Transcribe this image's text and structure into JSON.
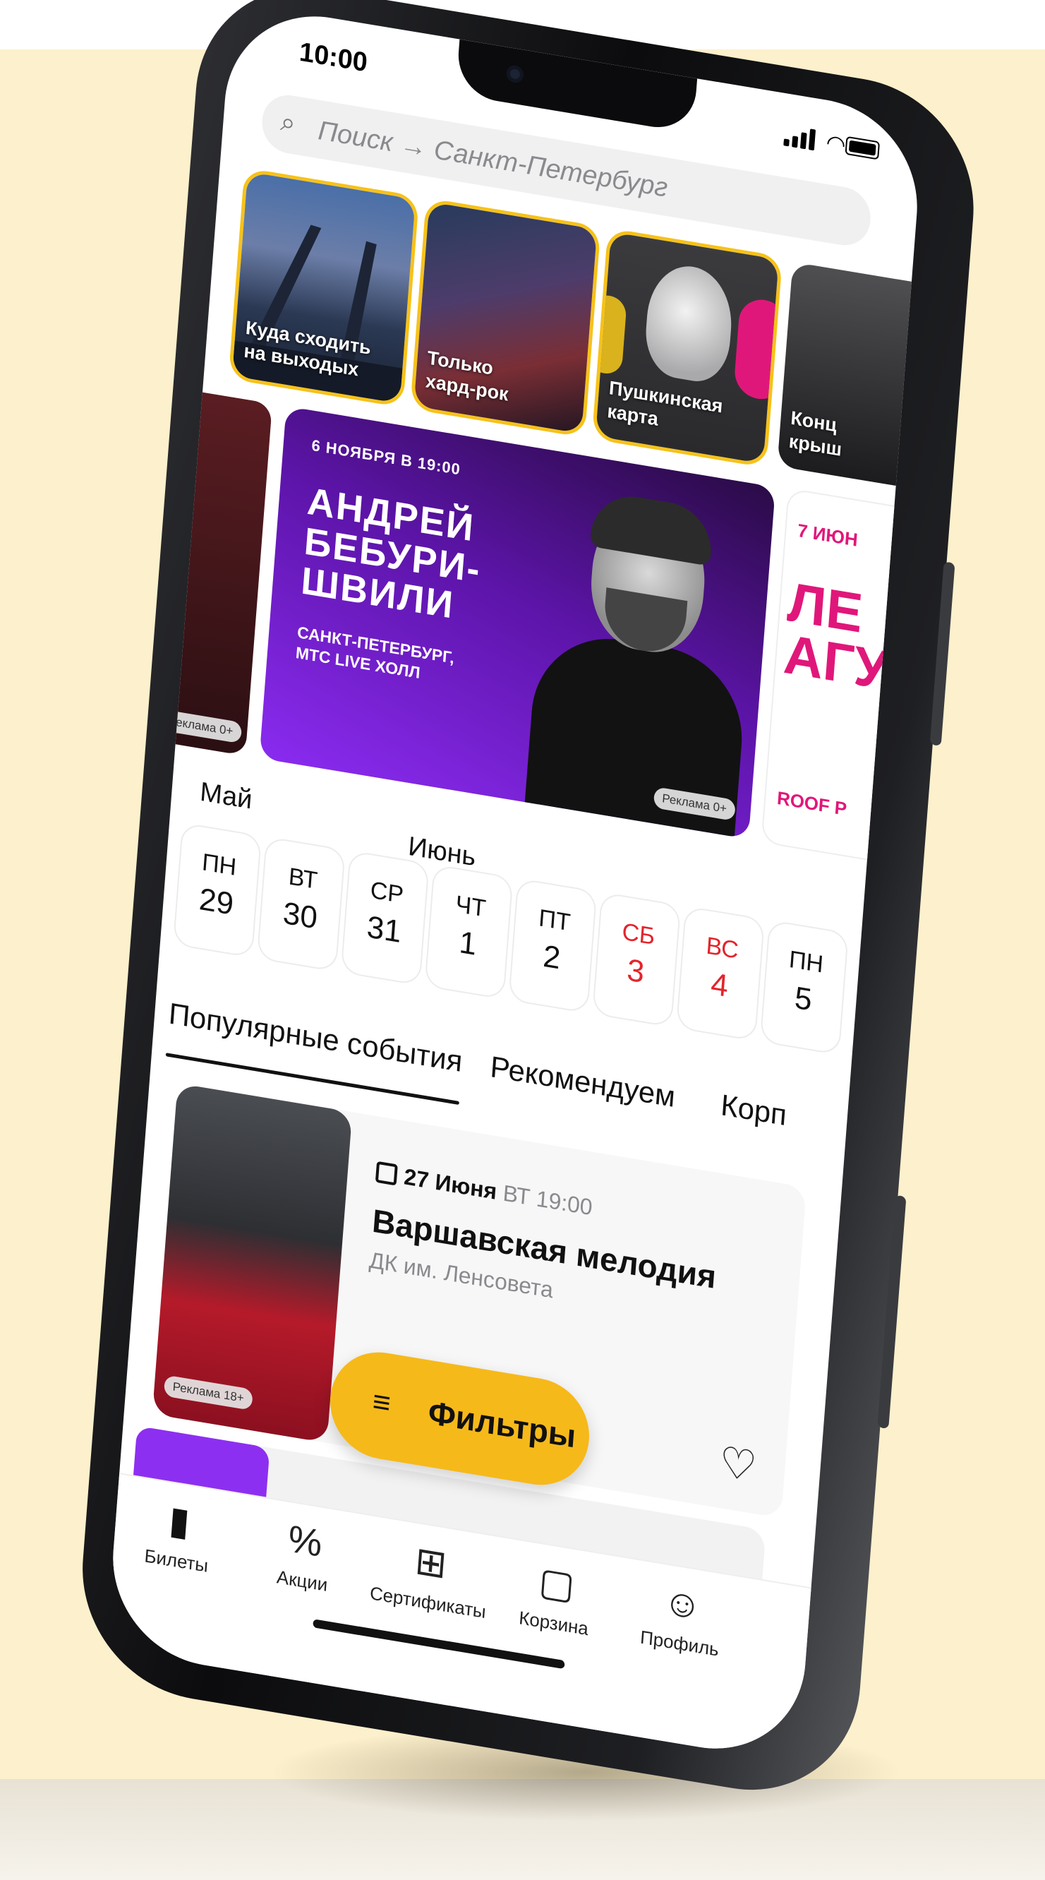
{
  "status_bar": {
    "time": "10:00"
  },
  "search": {
    "placeholder": "Поиск → Санкт-Петербург"
  },
  "stories": [
    {
      "label": "Куда сходить\nна выходых"
    },
    {
      "label": "Только\nхард-рок"
    },
    {
      "label": "Пушкинская\nкарта"
    },
    {
      "label": "Конц\nкрыш"
    }
  ],
  "banners": {
    "left": {
      "ad_label": "Реклама 0+"
    },
    "main": {
      "date": "6 НОЯБРЯ В 19:00",
      "name": "АНДРЕЙ\nБЕБУРИ-\nШВИЛИ",
      "venue": "САНКТ-ПЕТЕРБУРГ,\nМТС LIVE ХОЛЛ",
      "ad_label": "Реклама 0+"
    },
    "right": {
      "date": "7 ИЮН",
      "title": "ЛЕ\nАГУ",
      "venue": "ROOF P"
    }
  },
  "calendar": {
    "months": [
      "Май",
      "Июнь"
    ],
    "days": [
      {
        "weekday": "ПН",
        "date": "29",
        "weekend": false
      },
      {
        "weekday": "ВТ",
        "date": "30",
        "weekend": false
      },
      {
        "weekday": "СР",
        "date": "31",
        "weekend": false
      },
      {
        "weekday": "ЧТ",
        "date": "1",
        "weekend": false
      },
      {
        "weekday": "ПТ",
        "date": "2",
        "weekend": false
      },
      {
        "weekday": "СБ",
        "date": "3",
        "weekend": true
      },
      {
        "weekday": "ВС",
        "date": "4",
        "weekend": true
      },
      {
        "weekday": "ПН",
        "date": "5",
        "weekend": false
      }
    ]
  },
  "tabs": [
    {
      "label": "Популярные события",
      "active": true
    },
    {
      "label": "Рекомендуем",
      "active": false
    },
    {
      "label": "Корп",
      "active": false
    }
  ],
  "event_card": {
    "date": "27 Июня",
    "weekday_time": "ВТ 19:00",
    "title": "Варшавская мелодия",
    "venue": "ДК им. Ленсовета",
    "ad_label": "Реклама 18+"
  },
  "filters_button": {
    "label": "Фильтры"
  },
  "tab_bar": [
    {
      "label": "Билеты",
      "icon": "ticket-icon",
      "active": true
    },
    {
      "label": "Акции",
      "icon": "percent-icon",
      "active": false
    },
    {
      "label": "Сертификаты",
      "icon": "gift-icon",
      "active": false
    },
    {
      "label": "Корзина",
      "icon": "bag-icon",
      "active": false
    },
    {
      "label": "Профиль",
      "icon": "profile-icon",
      "active": false
    }
  ],
  "colors": {
    "accent": "#f6b91a",
    "weekend": "#e3242b",
    "banner_purple": "#5c14a8",
    "background": "#fdf0cc"
  }
}
